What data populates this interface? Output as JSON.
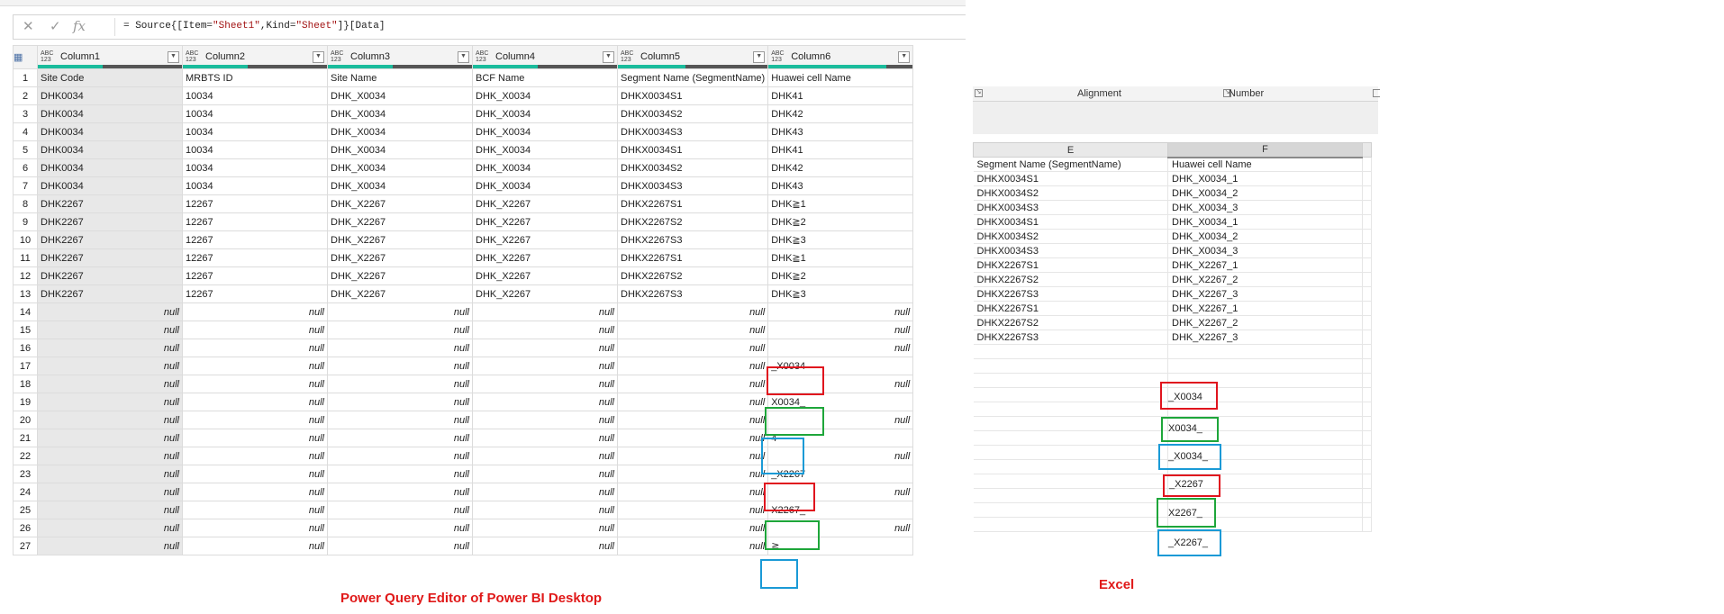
{
  "formula_bar": {
    "cancel_icon": "close-icon",
    "confirm_icon": "check-icon",
    "fx_label": "fx",
    "formula_prefix": "= Source{[Item=",
    "formula_item": "\"Sheet1\"",
    "formula_mid": ",Kind=",
    "formula_kind": "\"Sheet\"",
    "formula_suffix": "]}[Data]"
  },
  "pq": {
    "type_label": "ABC\n123",
    "columns": [
      "Column1",
      "Column2",
      "Column3",
      "Column4",
      "Column5",
      "Column6"
    ],
    "rows": [
      [
        "1",
        "Site Code",
        "MRBTS ID",
        "Site Name",
        "BCF Name",
        "Segment Name (SegmentName)",
        "Huawei cell Name"
      ],
      [
        "2",
        "DHK0034",
        "10034",
        "DHK_X0034",
        "DHK_X0034",
        "DHKX0034S1",
        "DHK41"
      ],
      [
        "3",
        "DHK0034",
        "10034",
        "DHK_X0034",
        "DHK_X0034",
        "DHKX0034S2",
        "DHK42"
      ],
      [
        "4",
        "DHK0034",
        "10034",
        "DHK_X0034",
        "DHK_X0034",
        "DHKX0034S3",
        "DHK43"
      ],
      [
        "5",
        "DHK0034",
        "10034",
        "DHK_X0034",
        "DHK_X0034",
        "DHKX0034S1",
        "DHK41"
      ],
      [
        "6",
        "DHK0034",
        "10034",
        "DHK_X0034",
        "DHK_X0034",
        "DHKX0034S2",
        "DHK42"
      ],
      [
        "7",
        "DHK0034",
        "10034",
        "DHK_X0034",
        "DHK_X0034",
        "DHKX0034S3",
        "DHK43"
      ],
      [
        "8",
        "DHK2267",
        "12267",
        "DHK_X2267",
        "DHK_X2267",
        "DHKX2267S1",
        "DHK≧1"
      ],
      [
        "9",
        "DHK2267",
        "12267",
        "DHK_X2267",
        "DHK_X2267",
        "DHKX2267S2",
        "DHK≧2"
      ],
      [
        "10",
        "DHK2267",
        "12267",
        "DHK_X2267",
        "DHK_X2267",
        "DHKX2267S3",
        "DHK≧3"
      ],
      [
        "11",
        "DHK2267",
        "12267",
        "DHK_X2267",
        "DHK_X2267",
        "DHKX2267S1",
        "DHK≧1"
      ],
      [
        "12",
        "DHK2267",
        "12267",
        "DHK_X2267",
        "DHK_X2267",
        "DHKX2267S2",
        "DHK≧2"
      ],
      [
        "13",
        "DHK2267",
        "12267",
        "DHK_X2267",
        "DHK_X2267",
        "DHKX2267S3",
        "DHK≧3"
      ],
      [
        "14",
        "null",
        "null",
        "null",
        "null",
        "null",
        "null"
      ],
      [
        "15",
        "null",
        "null",
        "null",
        "null",
        "null",
        "null"
      ],
      [
        "16",
        "null",
        "null",
        "null",
        "null",
        "null",
        "null"
      ],
      [
        "17",
        "null",
        "null",
        "null",
        "null",
        "null",
        "_X0034"
      ],
      [
        "18",
        "null",
        "null",
        "null",
        "null",
        "null",
        "null"
      ],
      [
        "19",
        "null",
        "null",
        "null",
        "null",
        "null",
        "X0034_"
      ],
      [
        "20",
        "null",
        "null",
        "null",
        "null",
        "null",
        "null"
      ],
      [
        "21",
        "null",
        "null",
        "null",
        "null",
        "null",
        "4"
      ],
      [
        "22",
        "null",
        "null",
        "null",
        "null",
        "null",
        "null"
      ],
      [
        "23",
        "null",
        "null",
        "null",
        "null",
        "null",
        "_X2267"
      ],
      [
        "24",
        "null",
        "null",
        "null",
        "null",
        "null",
        "null"
      ],
      [
        "25",
        "null",
        "null",
        "null",
        "null",
        "null",
        "X2267_"
      ],
      [
        "26",
        "null",
        "null",
        "null",
        "null",
        "null",
        "null"
      ],
      [
        "27",
        "null",
        "null",
        "null",
        "null",
        "null",
        "≧"
      ]
    ],
    "caption": "Power Query Editor of Power BI Desktop"
  },
  "excel": {
    "ribbon_alignment": "Alignment",
    "ribbon_number": "Number",
    "col_e": "E",
    "col_f": "F",
    "rows": [
      [
        "Segment Name (SegmentName)",
        "Huawei cell Name"
      ],
      [
        "DHKX0034S1",
        "DHK_X0034_1"
      ],
      [
        "DHKX0034S2",
        "DHK_X0034_2"
      ],
      [
        "DHKX0034S3",
        "DHK_X0034_3"
      ],
      [
        "DHKX0034S1",
        "DHK_X0034_1"
      ],
      [
        "DHKX0034S2",
        "DHK_X0034_2"
      ],
      [
        "DHKX0034S3",
        "DHK_X0034_3"
      ],
      [
        "DHKX2267S1",
        "DHK_X2267_1"
      ],
      [
        "DHKX2267S2",
        "DHK_X2267_2"
      ],
      [
        "DHKX2267S3",
        "DHK_X2267_3"
      ],
      [
        "DHKX2267S1",
        "DHK_X2267_1"
      ],
      [
        "DHKX2267S2",
        "DHK_X2267_2"
      ],
      [
        "DHKX2267S3",
        "DHK_X2267_3"
      ]
    ],
    "extra_cells": [
      "_X0034",
      "X0034_",
      "_X0034_",
      "_X2267",
      "X2267_",
      "_X2267_"
    ],
    "caption": "Excel"
  },
  "colors": {
    "red": "#e0141e",
    "green": "#1ea63a",
    "blue": "#1a9ad6",
    "selected_header": "#f2c811",
    "quality_bar": "#1abc9c"
  }
}
